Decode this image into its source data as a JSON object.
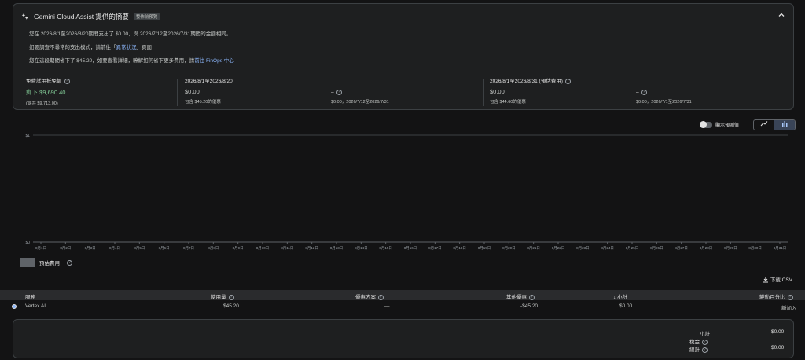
{
  "gemini": {
    "title": "Gemini Cloud Assist 提供的摘要",
    "badge": "發佈前預覽",
    "line1": "您在 2026/8/1至2026/8/20期間支出了 $0.00，與 2026/7/12至2026/7/31期間的金額相同。",
    "line2_prefix": "如要調查不尋常的支出模式，請前往「",
    "line2_link": "異常狀況",
    "line2_suffix": "」頁面",
    "line3_prefix": "您在這段期間省下了 $45.20，如要查看詳細，瞭解如何省下更多費用，請",
    "line3_link": "前往 FinOps 中心"
  },
  "stats": {
    "s1_title": "免費試用抵免額",
    "s1_value": "剩下 $9,690.40",
    "s1_sub": "(總共 $9,713.00)",
    "s2_title": "2026/8/1至2026/8/20",
    "s2_value": "$0.00",
    "s2_sub": "包含 $45.20的優惠",
    "s2_change": "–",
    "s2_compare": "$0.00，2026/7/12至2026/7/31",
    "s3_title": "2026/8/1至2026/8/31 (預估費用)",
    "s3_value": "$0.00",
    "s3_sub": "包含 $44.60的優惠",
    "s3_change": "–",
    "s3_compare": "$0.00，2026/7/1至2026/7/31"
  },
  "chart_controls": {
    "toggle_label": "顯示預測值",
    "line_icon": "line-chart-icon",
    "bar_icon": "bar-chart-icon"
  },
  "chart_data": {
    "type": "bar",
    "categories": [
      "8月1日",
      "8月2日",
      "8月3日",
      "8月4日",
      "8月5日",
      "8月6日",
      "8月7日",
      "8月8日",
      "8月9日",
      "8月10日",
      "8月11日",
      "8月12日",
      "8月13日",
      "8月14日",
      "8月15日",
      "8月16日",
      "8月17日",
      "8月18日",
      "8月19日",
      "8月20日",
      "8月21日",
      "8月22日",
      "8月23日",
      "8月24日",
      "8月25日",
      "8月26日",
      "8月27日",
      "8月28日",
      "8月29日",
      "8月30日",
      "8月31日"
    ],
    "series": [
      {
        "name": "預估費用",
        "values": [
          0,
          0,
          0,
          0,
          0,
          0,
          0,
          0,
          0,
          0,
          0,
          0,
          0,
          0,
          0,
          0,
          0,
          0,
          0,
          0,
          0,
          0,
          0,
          0,
          0,
          0,
          0,
          0,
          0,
          0,
          0
        ]
      }
    ],
    "y_ticks": [
      "$1",
      "$0"
    ],
    "ylim": [
      0,
      1
    ]
  },
  "legend_label": "預估費用",
  "download_label": "下載 CSV",
  "table": {
    "headers": {
      "service": "服務",
      "usage": "使用量",
      "discounts": "優惠方案",
      "other": "其他優惠",
      "subtotal": "小計",
      "change": "變動百分比"
    },
    "rows": [
      {
        "service": "Vertex AI",
        "usage": "$45.20",
        "discounts": "—",
        "other": "-$45.20",
        "subtotal": "$0.00",
        "change": "新加入"
      }
    ]
  },
  "totals": {
    "subtotal_label": "小計",
    "subtotal_value": "$0.00",
    "tax_label": "稅金",
    "tax_value": "—",
    "total_label": "總計",
    "total_value": "$0.00"
  },
  "colors": {
    "background": "#131314",
    "card": "#1e1f20",
    "accent": "#8ab4f8",
    "positive": "#81c995"
  }
}
